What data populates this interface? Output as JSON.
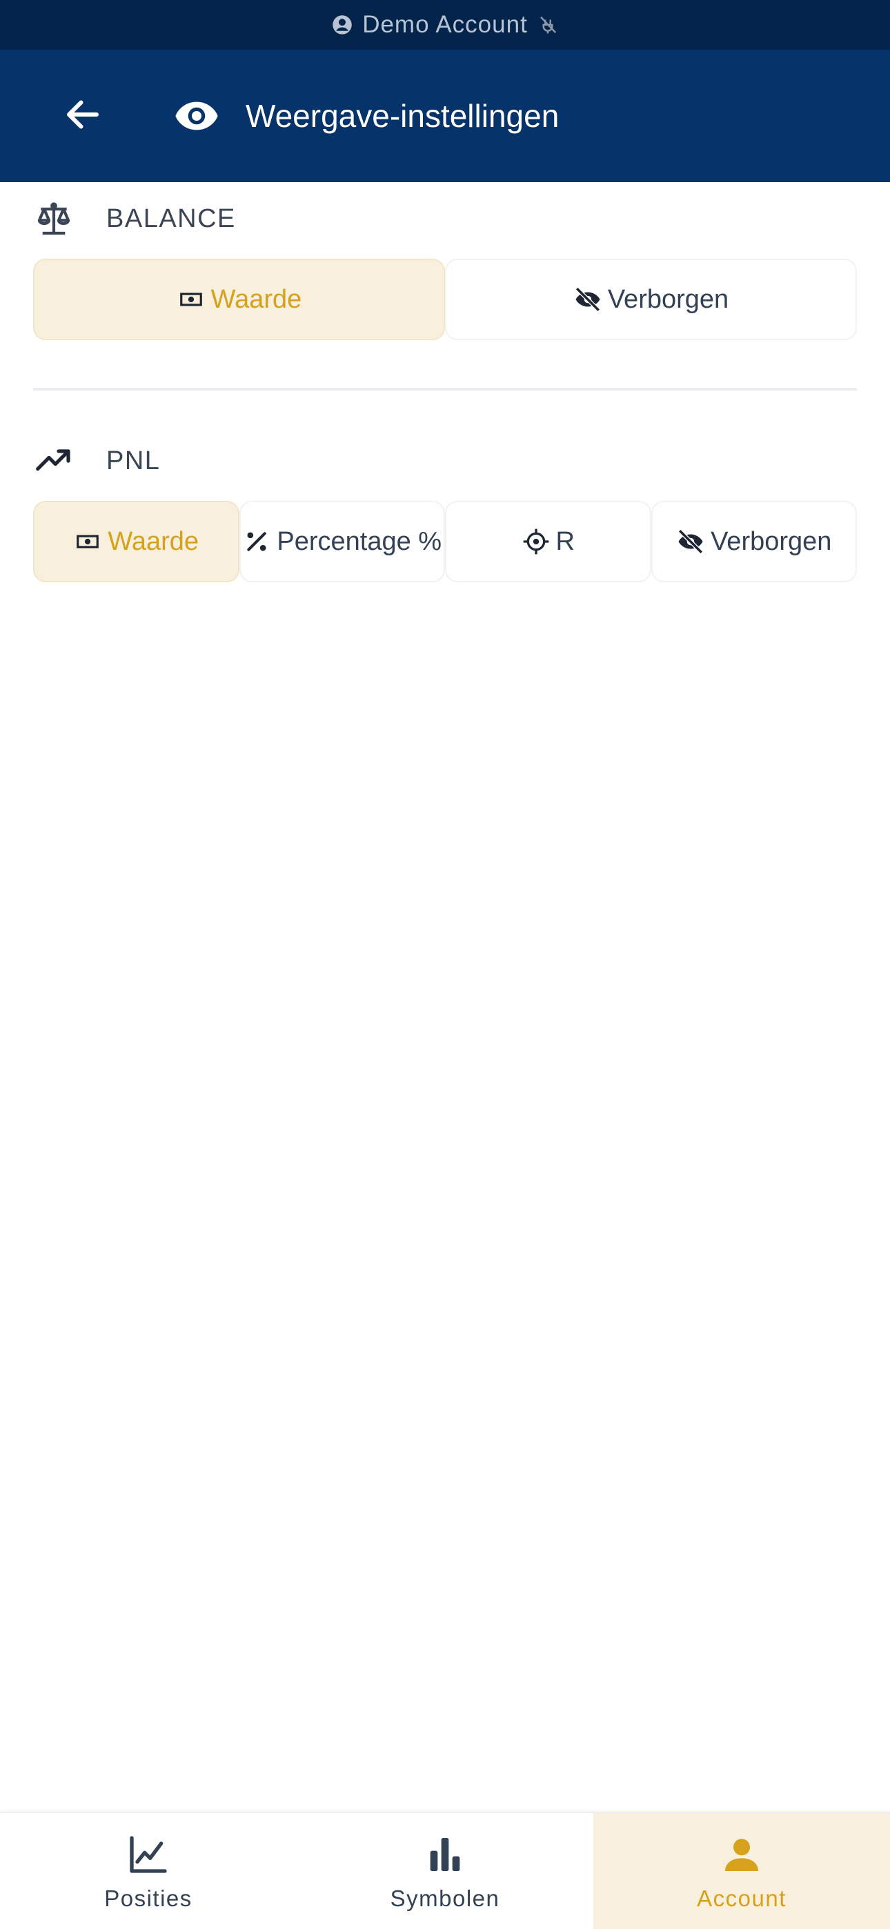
{
  "status_strip": {
    "label": "Demo Account",
    "icon_left": "account-circle-icon",
    "icon_right": "link-off-icon"
  },
  "app_bar": {
    "title": "Weergave-instellingen",
    "back_icon": "arrow-left-icon",
    "title_icon": "eye-icon"
  },
  "balance": {
    "header": "BALANCE",
    "icon": "scale-balance-icon",
    "options": [
      {
        "label": "Waarde",
        "icon": "cash-icon",
        "selected": true
      },
      {
        "label": "Verborgen",
        "icon": "eye-off-icon",
        "selected": false
      }
    ]
  },
  "pnl": {
    "header": "PNL",
    "icon": "trending-up-icon",
    "options": [
      {
        "label": "Waarde",
        "icon": "cash-icon",
        "selected": true
      },
      {
        "label": "Percentage %",
        "icon": "percent-icon",
        "selected": false
      },
      {
        "label": "R",
        "icon": "crosshair-icon",
        "selected": false
      },
      {
        "label": "Verborgen",
        "icon": "eye-off-icon",
        "selected": false
      }
    ]
  },
  "bottom_nav": {
    "items": [
      {
        "label": "Posities",
        "icon": "chart-line-icon",
        "active": false
      },
      {
        "label": "Symbolen",
        "icon": "bar-chart-icon",
        "active": false
      },
      {
        "label": "Account",
        "icon": "person-icon",
        "active": true
      }
    ]
  },
  "colors": {
    "header_bg": "#05336a",
    "status_bg": "#03244a",
    "accent": "#d6a21d",
    "accent_bg": "#f8f0dd",
    "text": "#334155"
  }
}
